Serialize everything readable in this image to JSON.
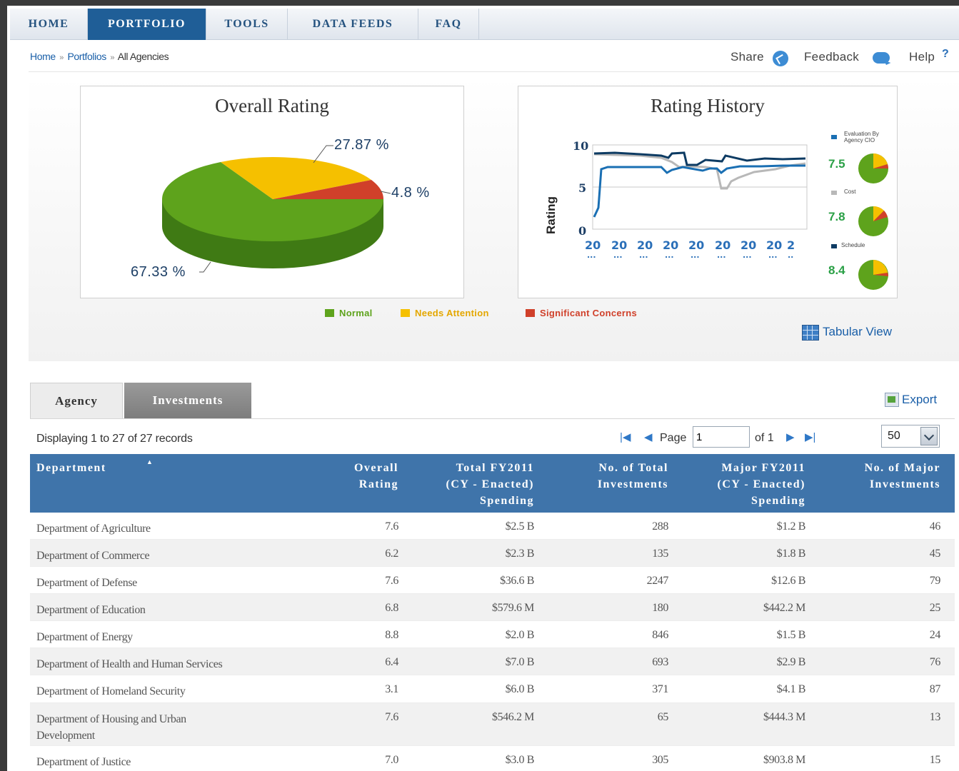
{
  "nav": {
    "tabs": [
      {
        "label": "HOME",
        "active": false
      },
      {
        "label": "PORTFOLIO",
        "active": true
      },
      {
        "label": "TOOLS",
        "active": false
      },
      {
        "label": "DATA FEEDS",
        "active": false
      },
      {
        "label": "FAQ",
        "active": false
      }
    ]
  },
  "breadcrumb": {
    "home": "Home",
    "sep": "»",
    "portfolios": "Portfolios",
    "current": "All Agencies"
  },
  "toolbar": {
    "share": "Share",
    "feedback": "Feedback",
    "help": "Help",
    "help_mark": "?"
  },
  "overall_rating": {
    "title": "Overall Rating",
    "labels": [
      "27.87 %",
      "4.8 %",
      "67.33 %"
    ]
  },
  "rating_history": {
    "title": "Rating History",
    "ylabel": "Rating",
    "yticks": [
      "10",
      "5",
      "0"
    ],
    "xticks": [
      "20",
      "20",
      "20",
      "20",
      "20",
      "20",
      "20",
      "20",
      "2"
    ],
    "xticks_sub": [
      "...",
      "...",
      "...",
      "...",
      "...",
      "...",
      "...",
      "...",
      ".."
    ],
    "side": [
      {
        "label": "Evaluation By Agency CIO",
        "value": "7.5",
        "color": "#1a6fb3"
      },
      {
        "label": "Cost",
        "value": "7.8",
        "color": "#b8b8b8"
      },
      {
        "label": "Schedule",
        "value": "8.4",
        "color": "#0d3b63"
      }
    ]
  },
  "legend": {
    "normal": "Normal",
    "needs": "Needs Attention",
    "significant": "Significant Concerns",
    "colors": {
      "normal": "#5ea31c",
      "needs": "#f5c000",
      "significant": "#d0402a"
    }
  },
  "tabular_view": "Tabular View",
  "tabs": {
    "agency": "Agency",
    "investments": "Investments"
  },
  "export": "Export",
  "records": {
    "text": "Displaying 1 to 27 of 27 records",
    "page_label": "Page",
    "page_value": "1",
    "of_label": "of 1",
    "page_size": "50"
  },
  "table": {
    "headers": {
      "department": "Department",
      "overall_1": "Overall",
      "overall_2": "Rating",
      "total_1": "Total FY2011",
      "total_2": "(CY - Enacted)",
      "total_3": "Spending",
      "ntotal_1": "No. of Total",
      "ntotal_2": "Investments",
      "major_1": "Major FY2011",
      "major_2": "(CY - Enacted)",
      "major_3": "Spending",
      "nmajor_1": "No. of Major",
      "nmajor_2": "Investments"
    },
    "rows": [
      {
        "department": "Department of Agriculture",
        "rating": "7.6",
        "total": "$2.5 B",
        "n_total": "288",
        "major": "$1.2 B",
        "n_major": "46"
      },
      {
        "department": "Department of Commerce",
        "rating": "6.2",
        "total": "$2.3 B",
        "n_total": "135",
        "major": "$1.8 B",
        "n_major": "45"
      },
      {
        "department": "Department of Defense",
        "rating": "7.6",
        "total": "$36.6 B",
        "n_total": "2247",
        "major": "$12.6 B",
        "n_major": "79"
      },
      {
        "department": "Department of Education",
        "rating": "6.8",
        "total": "$579.6 M",
        "n_total": "180",
        "major": "$442.2 M",
        "n_major": "25"
      },
      {
        "department": "Department of Energy",
        "rating": "8.8",
        "total": "$2.0 B",
        "n_total": "846",
        "major": "$1.5 B",
        "n_major": "24"
      },
      {
        "department": "Department of Health and Human Services",
        "rating": "6.4",
        "total": "$7.0 B",
        "n_total": "693",
        "major": "$2.9 B",
        "n_major": "76"
      },
      {
        "department": "Department of Homeland Security",
        "rating": "3.1",
        "total": "$6.0 B",
        "n_total": "371",
        "major": "$4.1 B",
        "n_major": "87"
      },
      {
        "department": "Department of Housing and Urban Development",
        "rating": "7.6",
        "total": "$546.2 M",
        "n_total": "65",
        "major": "$444.3 M",
        "n_major": "13"
      },
      {
        "department": "Department of Justice",
        "rating": "7.0",
        "total": "$3.0 B",
        "n_total": "305",
        "major": "$903.8 M",
        "n_major": "15"
      }
    ]
  }
}
